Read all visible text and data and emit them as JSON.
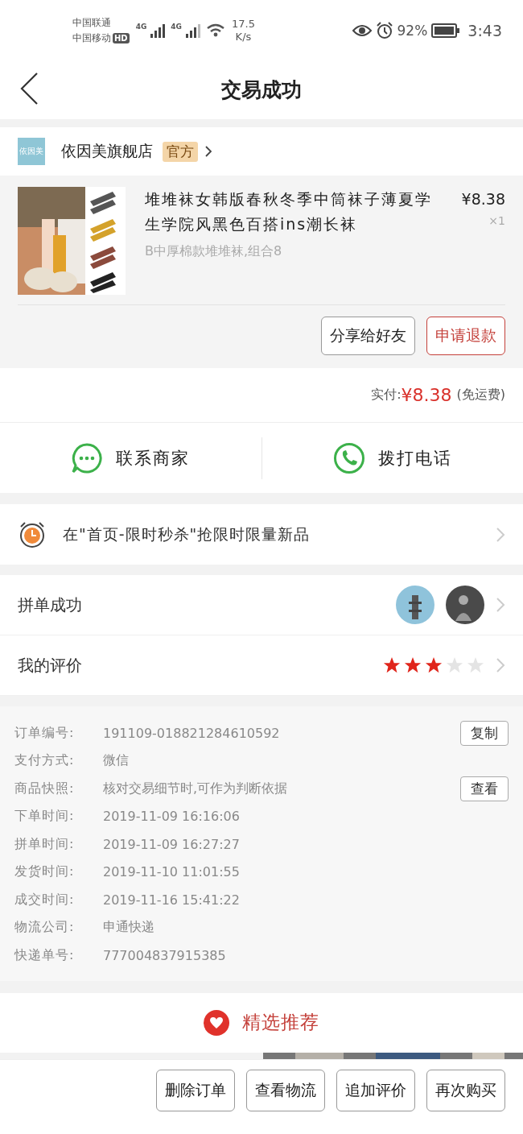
{
  "status_bar": {
    "carrier_1": "中国联通",
    "carrier_2": "中国移动",
    "hd": "HD",
    "net_1": "4G",
    "net_2": "4G",
    "speed": "17.5",
    "speed_unit": "K/s",
    "battery": "92%",
    "time": "3:43"
  },
  "nav": {
    "title": "交易成功"
  },
  "store": {
    "logo_text": "依因美",
    "name": "依因美旗舰店",
    "badge": "官方"
  },
  "product": {
    "title": "堆堆袜女韩版春秋冬季中筒袜子薄夏学生学院风黑色百搭ins潮长袜",
    "spec": "B中厚棉款堆堆袜,组合8",
    "price": "¥8.38",
    "quantity": "×1",
    "buttons": [
      {
        "label": "分享给好友",
        "kind": "plain"
      },
      {
        "label": "申请退款",
        "kind": "accent"
      }
    ]
  },
  "payment": {
    "label": "实付:",
    "amount": "¥8.38",
    "note": "(免运费)"
  },
  "contact": [
    {
      "label": "联系商家",
      "kind": "chat"
    },
    {
      "label": "拨打电话",
      "kind": "phone"
    }
  ],
  "promo": {
    "text": "在\"首页-限时秒杀\"抢限时限量新品"
  },
  "group_buy": {
    "label": "拼单成功"
  },
  "review": {
    "label": "我的评价",
    "stars": 3
  },
  "details": [
    {
      "label": "订单编号:",
      "value": "191109-018821284610592",
      "action": "复制"
    },
    {
      "label": "支付方式:",
      "value": "微信"
    },
    {
      "label": "商品快照:",
      "value": "核对交易细节时,可作为判断依据",
      "action": "查看"
    },
    {
      "label": "下单时间:",
      "value": "2019-11-09 16:16:06"
    },
    {
      "label": "拼单时间:",
      "value": "2019-11-09 16:27:27"
    },
    {
      "label": "发货时间:",
      "value": "2019-11-10 11:01:55"
    },
    {
      "label": "成交时间:",
      "value": "2019-11-16 15:41:22"
    },
    {
      "label": "物流公司:",
      "value": "申通快递"
    },
    {
      "label": "快递单号:",
      "value": "777004837915385"
    }
  ],
  "recommend": {
    "title": "精选推荐"
  },
  "bottom_buttons": [
    "删除订单",
    "查看物流",
    "追加评价",
    "再次购买"
  ]
}
